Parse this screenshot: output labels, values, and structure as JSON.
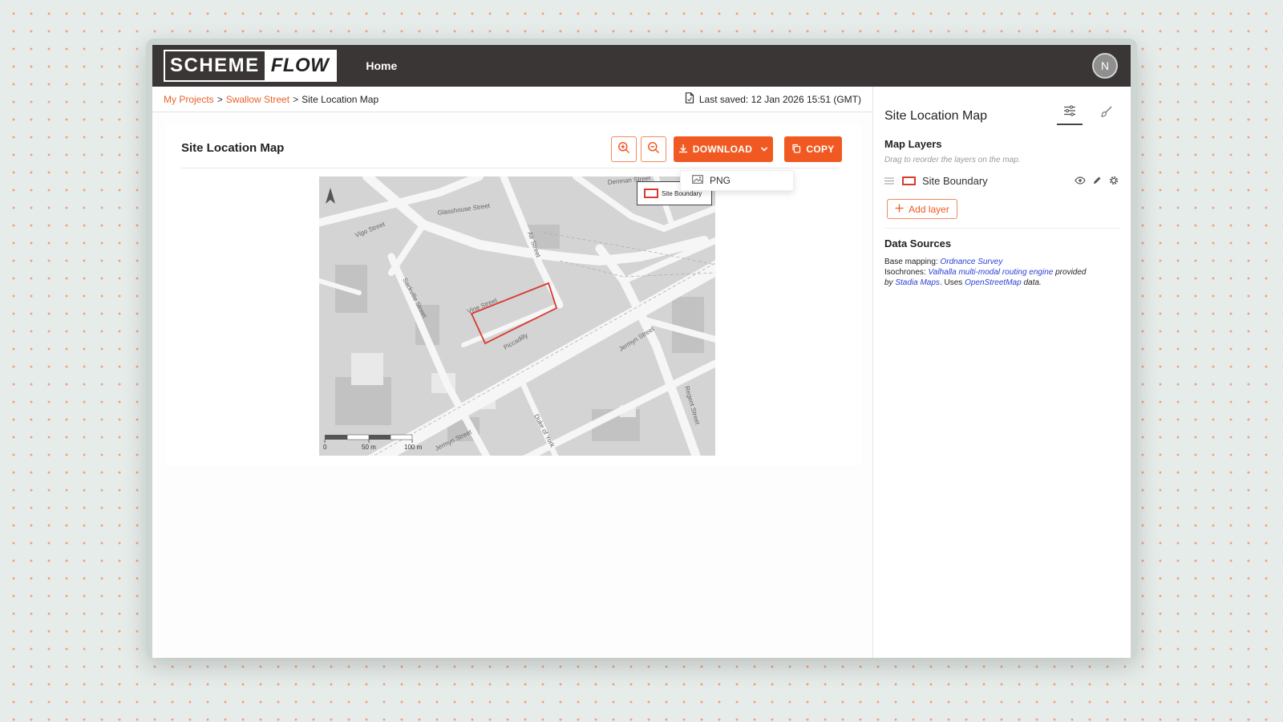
{
  "brand": {
    "part1": "SCHEME",
    "part2": "FLOW"
  },
  "nav": {
    "home": "Home"
  },
  "user": {
    "initial": "N"
  },
  "breadcrumb": {
    "projects": "My Projects",
    "sep1": ">",
    "project": "Swallow Street",
    "sep2": ">",
    "current": "Site Location Map"
  },
  "last_saved": "Last saved: 12 Jan 2026 15:51 (GMT)",
  "card": {
    "title": "Site Location Map",
    "download_label": "DOWNLOAD",
    "copy_label": "COPY",
    "dropdown_option": "PNG"
  },
  "map": {
    "legend_label": "Site Boundary",
    "scale_labels": [
      "0",
      "50 m",
      "100 m"
    ],
    "streets": [
      "Glasshouse Street",
      "Vigo Street",
      "Denman Street",
      "Air Street",
      "Sackville Street",
      "Vine Street",
      "Piccadilly",
      "Jermyn Street",
      "Jermyn Street",
      "Duke of York",
      "Regent Street"
    ],
    "boundary_color": "#d83a2e"
  },
  "panel": {
    "title": "Site Location Map",
    "layers_title": "Map Layers",
    "layers_hint": "Drag to reorder the layers on the map.",
    "layers": [
      {
        "name": "Site Boundary"
      }
    ],
    "add_layer": "Add layer",
    "sources_title": "Data Sources",
    "sources": {
      "base_label": "Base mapping:",
      "base_link": "Ordnance Survey",
      "iso_label": "Isochrones:",
      "iso_link": "Valhalla multi-modal routing engine",
      "provided": "provided",
      "by": "by",
      "stadia_link": "Stadia Maps",
      "uses": ". Uses",
      "osm_link": "OpenStreetMap",
      "data": "data."
    }
  },
  "colors": {
    "accent": "#f05a22",
    "topbar": "#3a3635",
    "link": "#2a3fd6"
  }
}
